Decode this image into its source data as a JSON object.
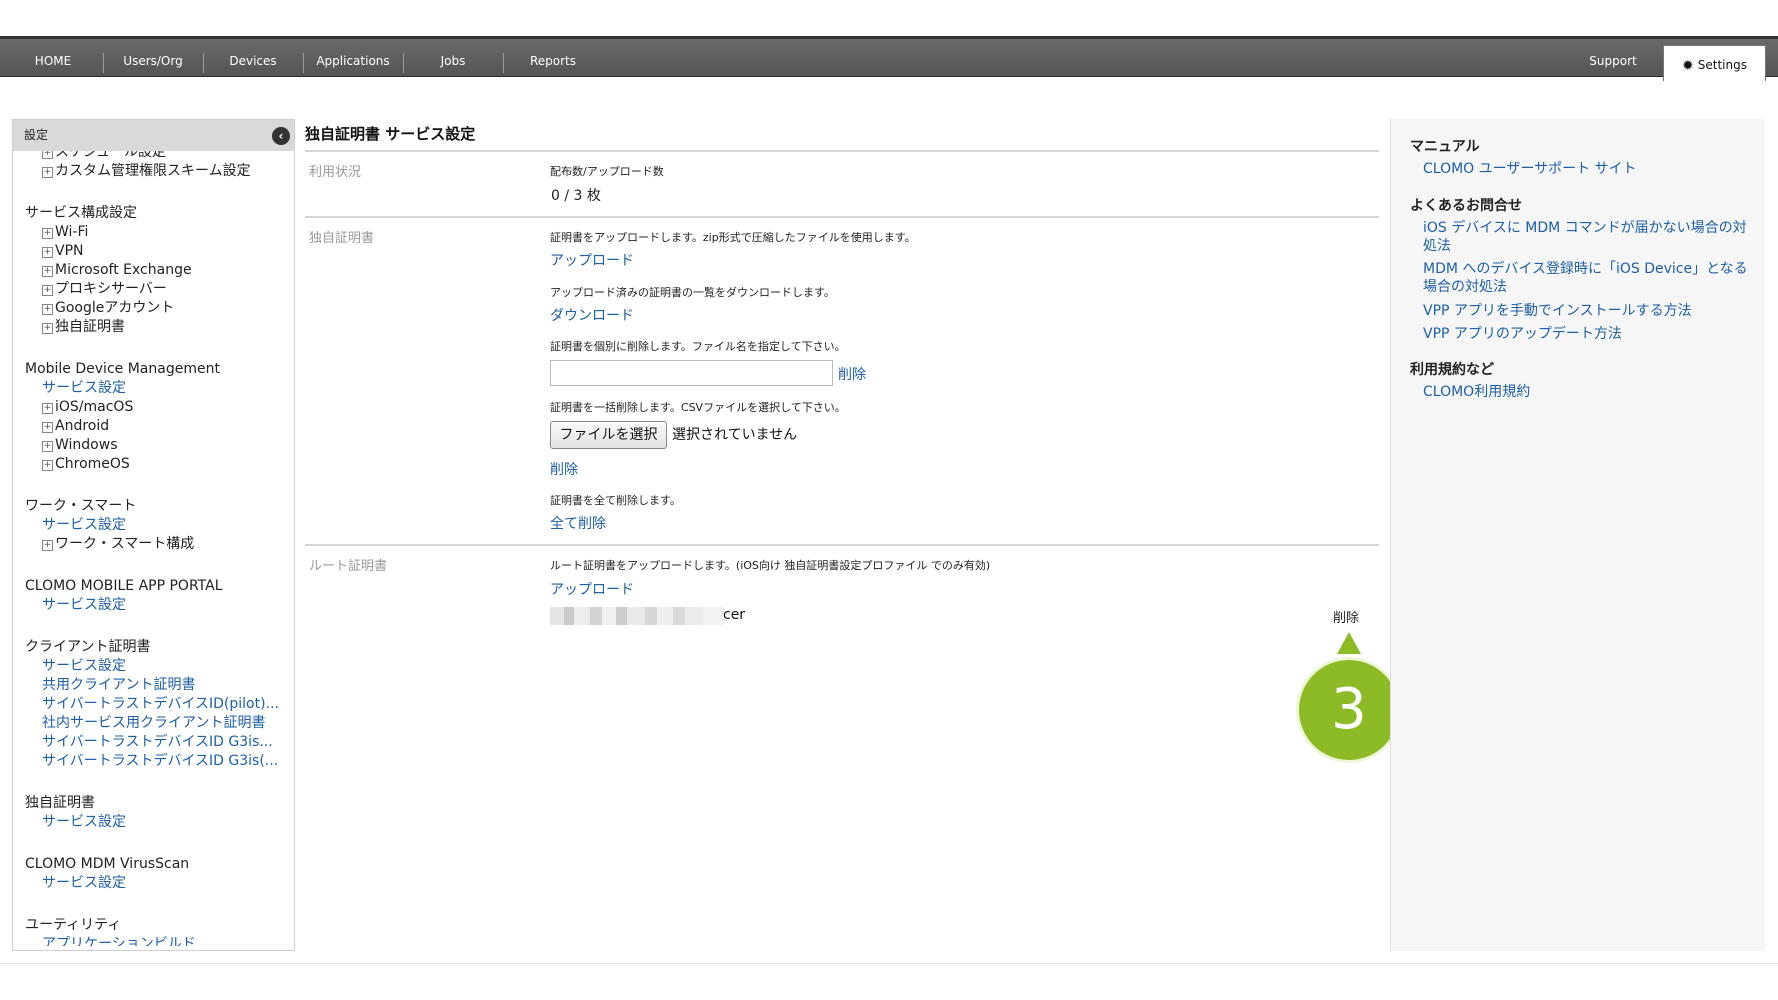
{
  "nav": {
    "items": [
      "HOME",
      "Users/Org",
      "Devices",
      "Applications",
      "Jobs",
      "Reports"
    ],
    "support": "Support",
    "settings": "Settings"
  },
  "sidebar": {
    "header": "設定",
    "lines": [
      {
        "text": "スケジュール設定",
        "kind": "sub"
      },
      {
        "text": "カスタム管理権限スキーム設定",
        "kind": "sub"
      },
      {
        "text": "サービス構成設定",
        "kind": "group"
      },
      {
        "text": "Wi-Fi",
        "kind": "sub"
      },
      {
        "text": "VPN",
        "kind": "sub"
      },
      {
        "text": "Microsoft Exchange",
        "kind": "sub"
      },
      {
        "text": "プロキシサーバー",
        "kind": "sub"
      },
      {
        "text": "Googleアカウント",
        "kind": "sub"
      },
      {
        "text": "独自証明書",
        "kind": "sub"
      },
      {
        "text": "Mobile Device Management",
        "kind": "group"
      },
      {
        "text": "サービス設定",
        "kind": "link"
      },
      {
        "text": "iOS/macOS",
        "kind": "sub"
      },
      {
        "text": "Android",
        "kind": "sub"
      },
      {
        "text": "Windows",
        "kind": "sub"
      },
      {
        "text": "ChromeOS",
        "kind": "sub"
      },
      {
        "text": "ワーク・スマート",
        "kind": "group"
      },
      {
        "text": "サービス設定",
        "kind": "link"
      },
      {
        "text": "ワーク・スマート構成",
        "kind": "sub"
      },
      {
        "text": "CLOMO MOBILE APP PORTAL",
        "kind": "group"
      },
      {
        "text": "サービス設定",
        "kind": "link"
      },
      {
        "text": "クライアント証明書",
        "kind": "group"
      },
      {
        "text": "サービス設定",
        "kind": "link"
      },
      {
        "text": "共用クライアント証明書",
        "kind": "link"
      },
      {
        "text": "サイバートラストデバイスID(pilot)...",
        "kind": "link"
      },
      {
        "text": "社内サービス用クライアント証明書",
        "kind": "link"
      },
      {
        "text": "サイバートラストデバイスID G3is...",
        "kind": "link"
      },
      {
        "text": "サイバートラストデバイスID G3is(...",
        "kind": "link"
      },
      {
        "text": "独自証明書",
        "kind": "group"
      },
      {
        "text": "サービス設定",
        "kind": "link"
      },
      {
        "text": "CLOMO MDM VirusScan",
        "kind": "group"
      },
      {
        "text": "サービス設定",
        "kind": "link"
      },
      {
        "text": "ユーティリティ",
        "kind": "group"
      },
      {
        "text": "アプリケーションビルド",
        "kind": "link"
      }
    ]
  },
  "main": {
    "title": "独自証明書 サービス設定",
    "usage": {
      "label": "利用状況",
      "caption": "配布数/アップロード数",
      "value": "0 / 3 枚"
    },
    "cert": {
      "label": "独自証明書",
      "upload_desc": "証明書をアップロードします。zip形式で圧縮したファイルを使用します。",
      "upload_link": "アップロード",
      "download_desc": "アップロード済みの証明書の一覧をダウンロードします。",
      "download_link": "ダウンロード",
      "delete_single_desc": "証明書を個別に削除します。ファイル名を指定して下さい。",
      "delete_single_link": "削除",
      "bulk_desc": "証明書を一括削除します。CSVファイルを選択して下さい。",
      "choose_file": "ファイルを選択",
      "no_file": "選択されていません",
      "bulk_delete_link": "削除",
      "delete_all_desc": "証明書を全て削除します。",
      "delete_all_link": "全て削除"
    },
    "root": {
      "label": "ルート証明書",
      "desc": "ルート証明書をアップロードします。(iOS向け 独自証明書設定プロファイル でのみ有効)",
      "upload_link": "アップロード",
      "file_suffix": "cer",
      "delete": "削除"
    },
    "callout": "3"
  },
  "right": {
    "manual_heading": "マニュアル",
    "manual_link": "CLOMO ユーザーサポート サイト",
    "faq_heading": "よくあるお問合せ",
    "faq_links": [
      "iOS デバイスに MDM コマンドが届かない場合の対処法",
      "MDM へのデバイス登録時に「iOS Device」となる場合の対処法",
      "VPP アプリを手動でインストールする方法",
      "VPP アプリのアップデート方法"
    ],
    "terms_heading": "利用規約など",
    "terms_link": "CLOMO利用規約"
  },
  "colors": {
    "link": "#1d5fa8",
    "nav_bg": "#5f5f5f",
    "callout": "#8cbb26"
  }
}
